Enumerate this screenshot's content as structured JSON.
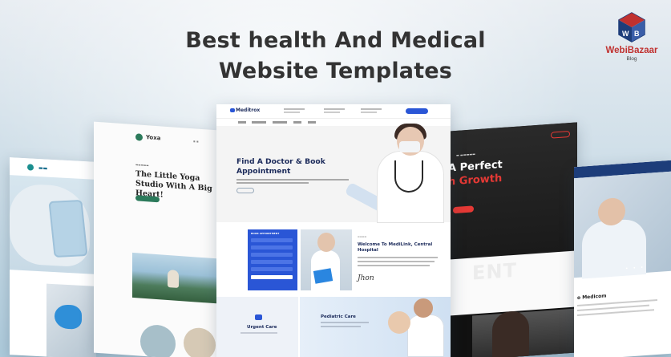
{
  "headline": {
    "line1": "Best health And Medical",
    "line2": "Website Templates"
  },
  "logo": {
    "brand": "WebiBazaar",
    "sub": "Blog",
    "icon": "cube-logo-icon",
    "colors": {
      "primary": "#c0312f",
      "secondary": "#1d3d7a"
    }
  },
  "cards": {
    "meditrox": {
      "brand": "Meditrox",
      "hero_title": "Find A Doctor & Book Appointment",
      "form_title": "BOOK APPOINTMENT",
      "welcome": "Welcome To MediLink, Central Hospital",
      "signature": "Jhon",
      "service1": "Urgent Care",
      "service2": "Pediatric Care",
      "accent": "#2a56d6"
    },
    "yoga": {
      "brand": "Yoxa",
      "title": "The Little Yoga Studio With A Big Heart!"
    },
    "gym": {
      "line1": "A Perfect",
      "line2": "h Growth",
      "ghost": "ENT",
      "accent": "#e53935"
    },
    "medicom": {
      "title": "o Medicom",
      "dots": "• • •"
    }
  }
}
